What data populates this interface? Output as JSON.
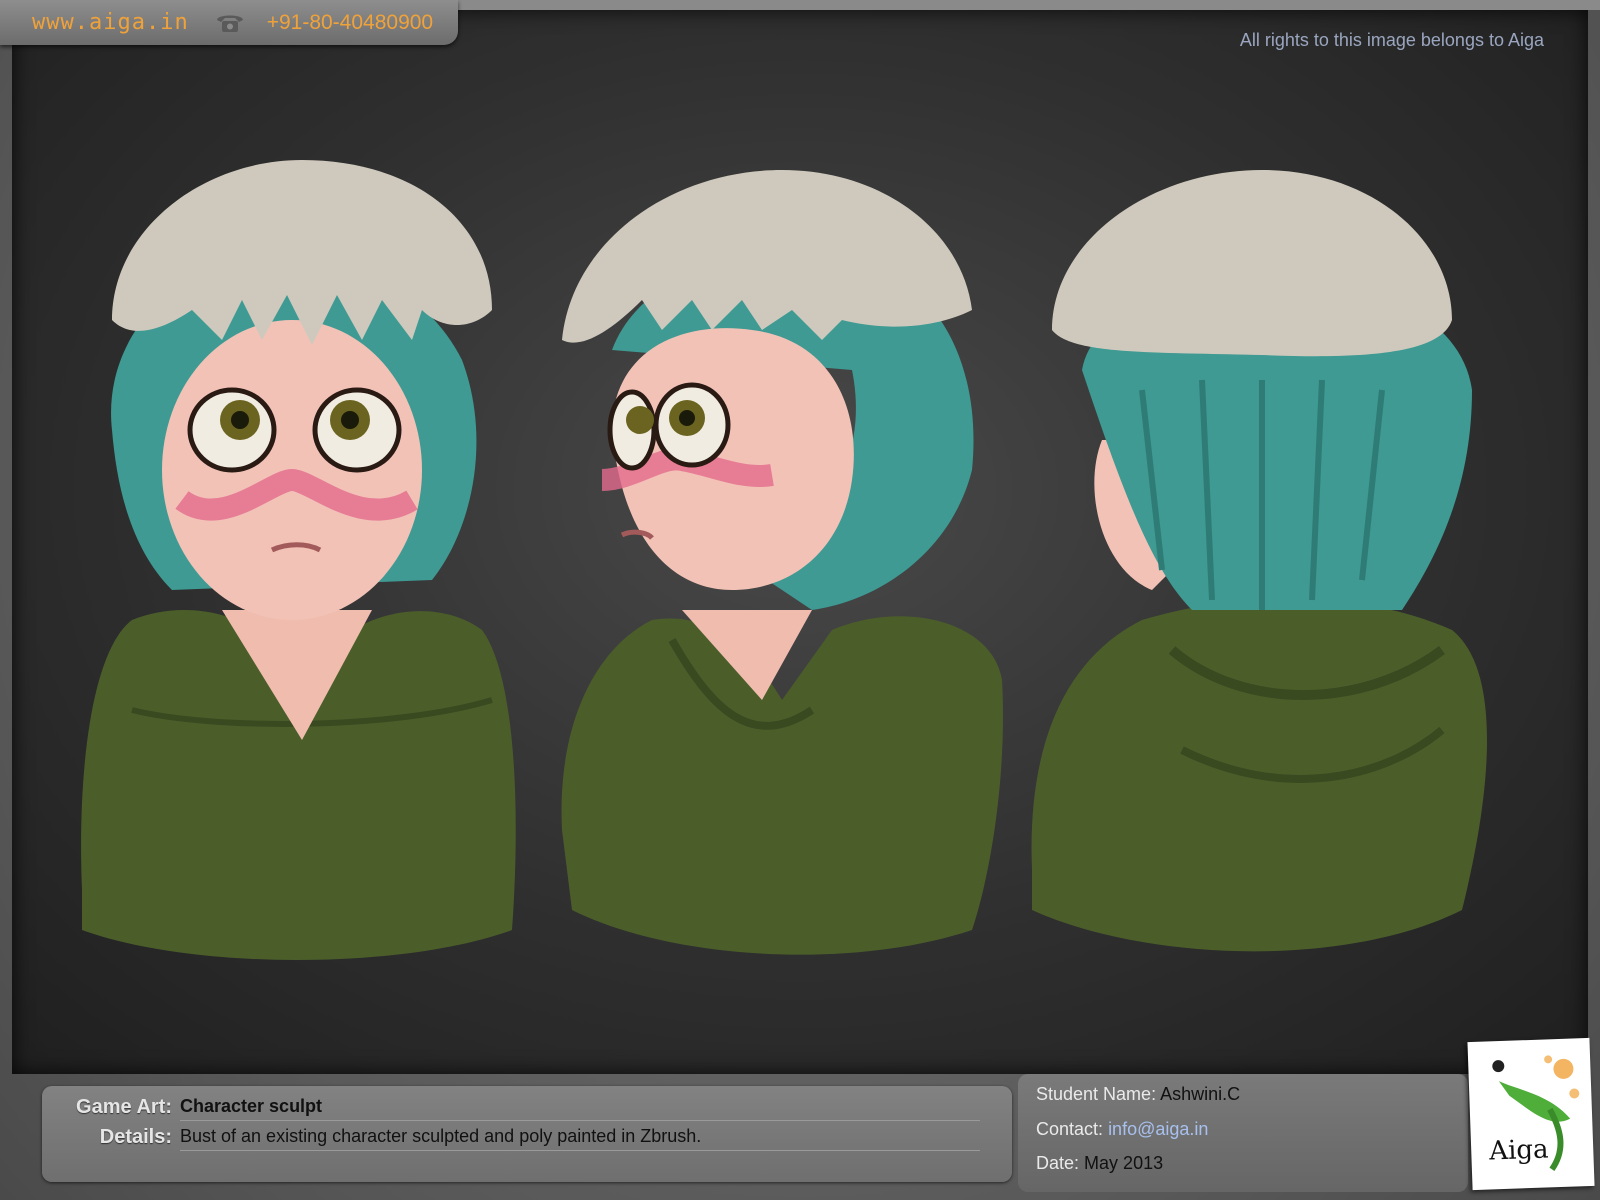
{
  "header": {
    "site": "www.aiga.in",
    "phone_icon": "phone-icon",
    "phone": "+91-80-40480900"
  },
  "rights_notice": "All rights to this image belongs to Aiga",
  "renders": [
    "front-view",
    "three-quarter-view",
    "back-view"
  ],
  "details": {
    "game_art_label": "Game Art:",
    "game_art_value": "Character sculpt",
    "details_label": "Details:",
    "details_value": "Bust of an existing character sculpted and poly painted in Zbrush."
  },
  "student": {
    "name_label": "Student Name:",
    "name_value": "Ashwini.C",
    "contact_label": "Contact:",
    "contact_value": "info@aiga.in",
    "date_label": "Date:",
    "date_value": "May 2013"
  },
  "logo_text": "Aiga",
  "colors": {
    "accent_orange": "#f0a23a",
    "hair_teal": "#3e9a93",
    "hoodie_green": "#4b5e2a",
    "skull_bone": "#cfc9bd",
    "skin": "#f2c2b6"
  }
}
